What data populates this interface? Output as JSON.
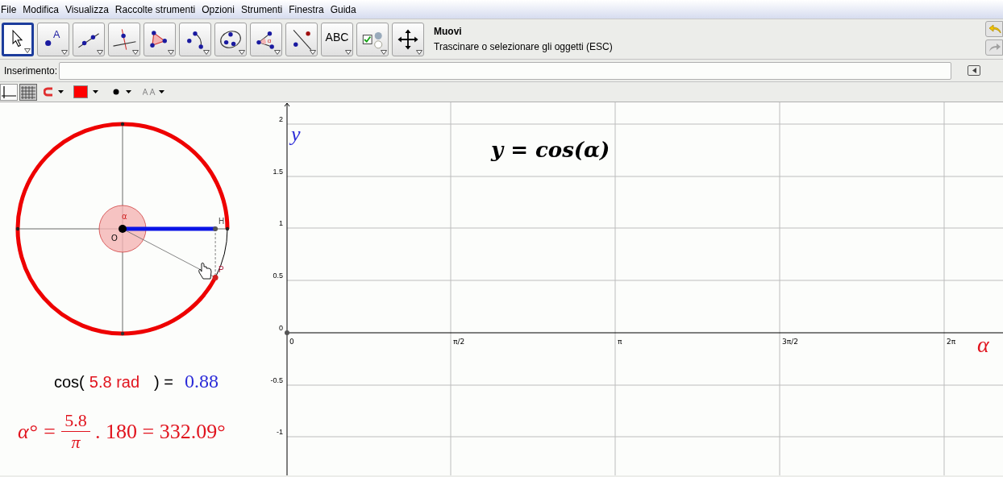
{
  "menu_bar": [
    "File",
    "Modifica",
    "Visualizza",
    "Raccolte strumenti",
    "Opzioni",
    "Strumenti",
    "Finestra",
    "Guida"
  ],
  "toolbar": {
    "tools": [
      {
        "kind": "move",
        "selected": true
      },
      {
        "kind": "point",
        "selected": false,
        "icon_text": "A"
      },
      {
        "kind": "line",
        "selected": false
      },
      {
        "kind": "perpendicular",
        "selected": false
      },
      {
        "kind": "polygon",
        "selected": false
      },
      {
        "kind": "arc",
        "selected": false
      },
      {
        "kind": "conic",
        "selected": false
      },
      {
        "kind": "angle",
        "selected": false,
        "icon_text": "α"
      },
      {
        "kind": "reflect",
        "selected": false
      },
      {
        "kind": "text",
        "selected": false,
        "label": "ABC"
      },
      {
        "kind": "checkbox",
        "selected": false
      },
      {
        "kind": "pan",
        "selected": false
      }
    ],
    "tool_name": "Muovi",
    "tool_help": "Trascinare o selezionare gli oggetti (ESC)"
  },
  "input_bar": {
    "label": "Inserimento:"
  },
  "style_bar": {
    "toggles": [
      {
        "kind": "axes",
        "selected": false
      },
      {
        "kind": "grid",
        "selected": true
      }
    ]
  },
  "graphics_1": {
    "angle_label": "α",
    "origin_label": "O",
    "h_label": "H",
    "p_label": "P",
    "cos_text": {
      "prefix": "cos(",
      "angle": "5.8 rad",
      "suffix": ") =",
      "value": "0.88"
    },
    "degree_formula": {
      "lhs": "α° =",
      "numerator": "5.8",
      "denominator": "π",
      "rhs": ". 180 = 332.09°"
    }
  },
  "graphics_2": {
    "y_axis_label": "y",
    "x_axis_label": "α",
    "function_text": "y = cos(α)",
    "y_tick_labels": [
      "2",
      "1.5",
      "1",
      "0.5",
      "0",
      "-0.5",
      "-1"
    ],
    "x_tick_labels": [
      "0",
      "π/2",
      "π",
      "3π/2",
      "2π"
    ]
  }
}
